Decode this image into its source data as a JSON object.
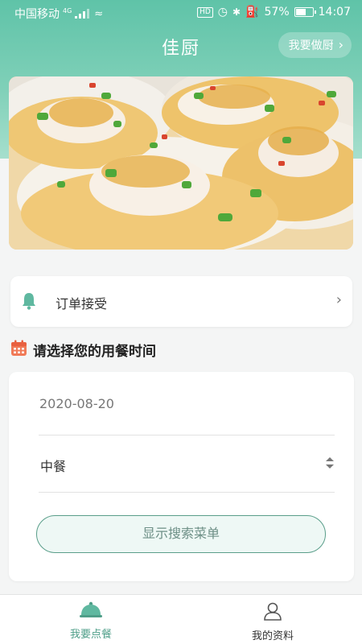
{
  "status_bar": {
    "carrier": "中国移动",
    "network": "4G",
    "battery": "57%",
    "time": "14:07"
  },
  "header": {
    "title": "佳厨",
    "cook_button": "我要做厨"
  },
  "banner": {
    "image_name": "food-banner",
    "slides": 5,
    "active_slide": 4
  },
  "notice": {
    "text": "订单接受"
  },
  "section": {
    "title": "请选择您的用餐时间"
  },
  "form": {
    "date": "2020-08-20",
    "meal": "中餐",
    "search_button": "显示搜索菜单"
  },
  "tabs": [
    {
      "label": "我要点餐",
      "icon": "dish-cover-icon",
      "active": true
    },
    {
      "label": "我的资料",
      "icon": "person-icon",
      "active": false
    }
  ],
  "colors": {
    "accent": "#5fc3a8",
    "active_tab": "#4e9e88",
    "button_border": "#5a9e8a"
  }
}
